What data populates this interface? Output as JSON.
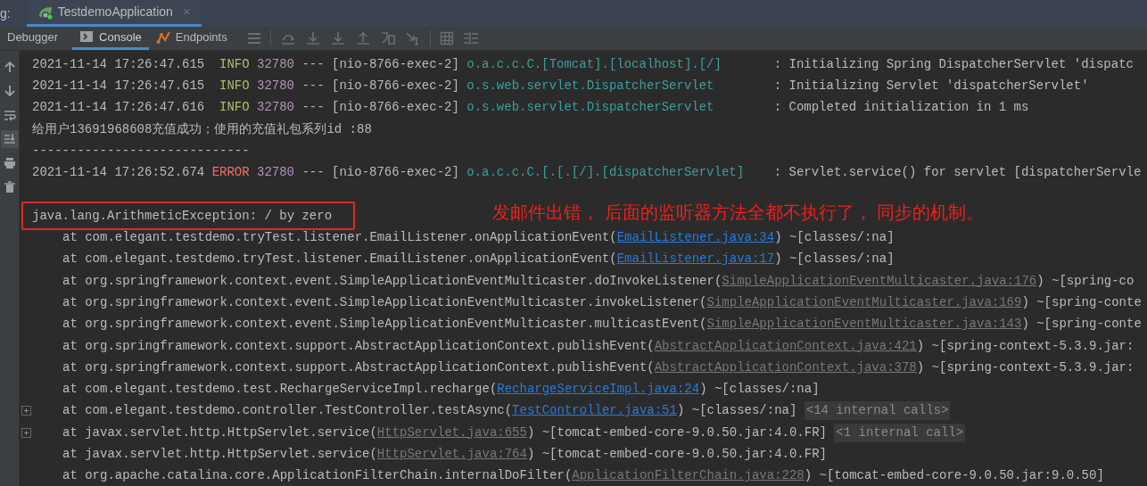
{
  "header": {
    "label": "g:",
    "run_tabs": [
      {
        "title": "TestdemoApplication",
        "selected": true,
        "close": "×"
      }
    ]
  },
  "tabs": [
    {
      "label": "Debugger",
      "kind": "debugger",
      "selected": false
    },
    {
      "label": "Console",
      "kind": "console",
      "selected": true
    },
    {
      "label": "Endpoints",
      "kind": "endpoints",
      "selected": false
    }
  ],
  "side_toolbar": [
    {
      "kind": "up",
      "selected": false
    },
    {
      "kind": "down",
      "selected": false
    },
    {
      "kind": "wrap",
      "selected": false
    },
    {
      "kind": "scroll-end",
      "selected": true
    },
    {
      "kind": "print",
      "selected": false
    },
    {
      "kind": "trash",
      "selected": false
    }
  ],
  "console": {
    "lines": [
      {
        "kind": "log",
        "segments": [
          {
            "kind": "ts",
            "text": "2021-11-14 17:26:47.615"
          },
          {
            "kind": "info",
            "text": "INFO"
          },
          {
            "kind": "pid",
            "text": "32780"
          },
          {
            "kind": "sep",
            "text": "---"
          },
          {
            "kind": "thread",
            "text": "[nio-8766-exec-2]"
          },
          {
            "kind": "logger",
            "text": "o.a.c.c.C.[Tomcat].[localhost].[/]"
          },
          {
            "kind": "msg",
            "text": ": Initializing Spring DispatcherServlet 'dispatc"
          }
        ]
      },
      {
        "kind": "log",
        "segments": [
          {
            "kind": "ts",
            "text": "2021-11-14 17:26:47.615"
          },
          {
            "kind": "info",
            "text": "INFO"
          },
          {
            "kind": "pid",
            "text": "32780"
          },
          {
            "kind": "sep",
            "text": "---"
          },
          {
            "kind": "thread",
            "text": "[nio-8766-exec-2]"
          },
          {
            "kind": "logger",
            "text": "o.s.web.servlet.DispatcherServlet"
          },
          {
            "kind": "msg",
            "text": ": Initializing Servlet 'dispatcherServlet'"
          }
        ]
      },
      {
        "kind": "log",
        "segments": [
          {
            "kind": "ts",
            "text": "2021-11-14 17:26:47.616"
          },
          {
            "kind": "info",
            "text": "INFO"
          },
          {
            "kind": "pid",
            "text": "32780"
          },
          {
            "kind": "sep",
            "text": "---"
          },
          {
            "kind": "thread",
            "text": "[nio-8766-exec-2]"
          },
          {
            "kind": "logger",
            "text": "o.s.web.servlet.DispatcherServlet"
          },
          {
            "kind": "msg",
            "text": ": Completed initialization in 1 ms"
          }
        ]
      },
      {
        "kind": "plain",
        "segments": [
          {
            "kind": "msg",
            "text": "给用户13691968608充值成功；使用的充值礼包系列id :88"
          }
        ]
      },
      {
        "kind": "plain",
        "segments": [
          {
            "kind": "msg",
            "text": "-----------------------------"
          }
        ]
      },
      {
        "kind": "log",
        "segments": [
          {
            "kind": "ts",
            "text": "2021-11-14 17:26:52.674"
          },
          {
            "kind": "error",
            "text": "ERROR"
          },
          {
            "kind": "pid",
            "text": "32780"
          },
          {
            "kind": "sep",
            "text": "---"
          },
          {
            "kind": "thread",
            "text": "[nio-8766-exec-2]"
          },
          {
            "kind": "logger",
            "text": "o.a.c.c.C.[.[.[/].[dispatcherServlet]"
          },
          {
            "kind": "msg",
            "text": ": Servlet.service() for servlet [dispatcherServle"
          }
        ]
      },
      {
        "kind": "blank"
      },
      {
        "kind": "exception",
        "boxed": true,
        "segments": [
          {
            "kind": "msg",
            "text": "java.lang.ArithmeticException: / by zero"
          }
        ],
        "note": "发邮件出错， 后面的监听器方法全都不执行了， 同步的机制。"
      },
      {
        "kind": "stack",
        "segments": [
          {
            "kind": "msg",
            "text": "at com.elegant.testdemo.tryTest.listener.EmailListener.onApplicationEvent("
          },
          {
            "kind": "link",
            "text": "EmailListener.java:34"
          },
          {
            "kind": "msg",
            "text": ") ~[classes/:na]"
          }
        ]
      },
      {
        "kind": "stack",
        "segments": [
          {
            "kind": "msg",
            "text": "at com.elegant.testdemo.tryTest.listener.EmailListener.onApplicationEvent("
          },
          {
            "kind": "link",
            "text": "EmailListener.java:17"
          },
          {
            "kind": "msg",
            "text": ") ~[classes/:na]"
          }
        ]
      },
      {
        "kind": "stack",
        "segments": [
          {
            "kind": "msg",
            "text": "at org.springframework.context.event.SimpleApplicationEventMulticaster.doInvokeListener("
          },
          {
            "kind": "lib-link",
            "text": "SimpleApplicationEventMulticaster.java:176"
          },
          {
            "kind": "msg",
            "text": ") ~[spring-co"
          }
        ]
      },
      {
        "kind": "stack",
        "segments": [
          {
            "kind": "msg",
            "text": "at org.springframework.context.event.SimpleApplicationEventMulticaster.invokeListener("
          },
          {
            "kind": "lib-link",
            "text": "SimpleApplicationEventMulticaster.java:169"
          },
          {
            "kind": "msg",
            "text": ") ~[spring-conte"
          }
        ]
      },
      {
        "kind": "stack",
        "segments": [
          {
            "kind": "msg",
            "text": "at org.springframework.context.event.SimpleApplicationEventMulticaster.multicastEvent("
          },
          {
            "kind": "lib-link",
            "text": "SimpleApplicationEventMulticaster.java:143"
          },
          {
            "kind": "msg",
            "text": ") ~[spring-conte"
          }
        ]
      },
      {
        "kind": "stack",
        "segments": [
          {
            "kind": "msg",
            "text": "at org.springframework.context.support.AbstractApplicationContext.publishEvent("
          },
          {
            "kind": "lib-link",
            "text": "AbstractApplicationContext.java:421"
          },
          {
            "kind": "msg",
            "text": ") ~[spring-context-5.3.9.jar:"
          }
        ]
      },
      {
        "kind": "stack",
        "segments": [
          {
            "kind": "msg",
            "text": "at org.springframework.context.support.AbstractApplicationContext.publishEvent("
          },
          {
            "kind": "lib-link",
            "text": "AbstractApplicationContext.java:378"
          },
          {
            "kind": "msg",
            "text": ") ~[spring-context-5.3.9.jar:"
          }
        ]
      },
      {
        "kind": "stack",
        "segments": [
          {
            "kind": "msg",
            "text": "at com.elegant.testdemo.test.RechargeServiceImpl.recharge("
          },
          {
            "kind": "link",
            "text": "RechargeServiceImpl.java:24"
          },
          {
            "kind": "msg",
            "text": ") ~[classes/:na]"
          }
        ]
      },
      {
        "kind": "stack",
        "foldable": true,
        "segments": [
          {
            "kind": "msg",
            "text": "at com.elegant.testdemo.controller.TestController.testAsync("
          },
          {
            "kind": "link",
            "text": "TestController.java:51"
          },
          {
            "kind": "msg",
            "text": ") ~[classes/:na]"
          },
          {
            "kind": "internal",
            "text": "<14 internal calls>"
          }
        ]
      },
      {
        "kind": "stack",
        "foldable": true,
        "segments": [
          {
            "kind": "msg",
            "text": "at javax.servlet.http.HttpServlet.service("
          },
          {
            "kind": "lib-link",
            "text": "HttpServlet.java:655"
          },
          {
            "kind": "msg",
            "text": ") ~[tomcat-embed-core-9.0.50.jar:4.0.FR]"
          },
          {
            "kind": "internal",
            "text": "<1 internal call>"
          }
        ]
      },
      {
        "kind": "stack",
        "segments": [
          {
            "kind": "msg",
            "text": "at javax.servlet.http.HttpServlet.service("
          },
          {
            "kind": "lib-link",
            "text": "HttpServlet.java:764"
          },
          {
            "kind": "msg",
            "text": ") ~[tomcat-embed-core-9.0.50.jar:4.0.FR]"
          }
        ]
      },
      {
        "kind": "stack",
        "segments": [
          {
            "kind": "msg",
            "text": "at org.apache.catalina.core.ApplicationFilterChain.internalDoFilter("
          },
          {
            "kind": "lib-link",
            "text": "ApplicationFilterChain.java:228"
          },
          {
            "kind": "msg",
            "text": ") ~[tomcat-embed-core-9.0.50.jar:9.0.50]"
          }
        ]
      }
    ]
  }
}
